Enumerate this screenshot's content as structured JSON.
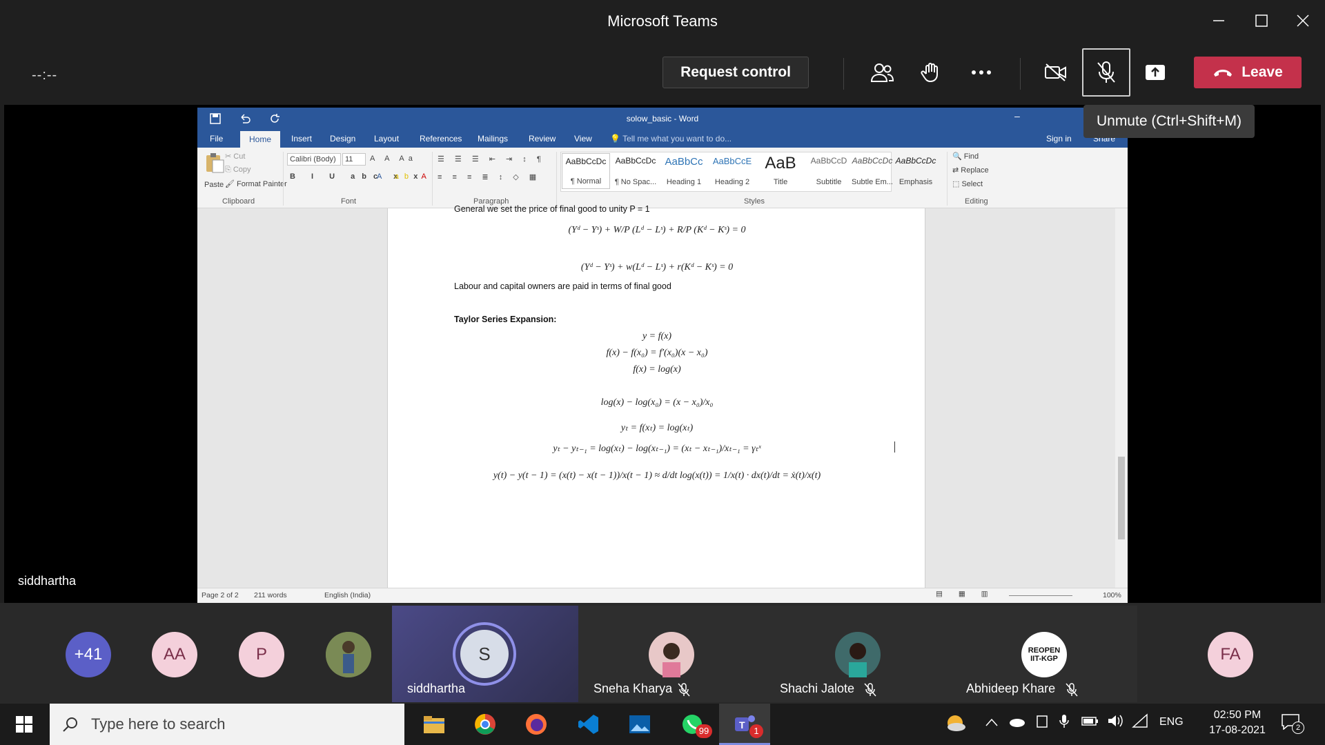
{
  "app": {
    "title": "Microsoft Teams"
  },
  "meeting": {
    "timer": "--:--",
    "request_control": "Request control",
    "leave": "Leave",
    "tooltip": "Unmute (Ctrl+Shift+M)",
    "presenter_label": "siddhartha"
  },
  "word": {
    "doc_title": "solow_basic - Word",
    "tabs": [
      "File",
      "Home",
      "Insert",
      "Design",
      "Layout",
      "References",
      "Mailings",
      "Review",
      "View"
    ],
    "tell_me": "Tell me what you want to do...",
    "sign_in": "Sign in",
    "share": "Share",
    "clipboard": {
      "paste": "Paste",
      "cut": "Cut",
      "copy": "Copy",
      "format_painter": "Format Painter",
      "label": "Clipboard"
    },
    "font": {
      "name": "Calibri (Body)",
      "size": "11",
      "label": "Font"
    },
    "paragraph_label": "Paragraph",
    "styles_label": "Styles",
    "styles": [
      {
        "sample": "AaBbCcDc",
        "name": "¶ Normal"
      },
      {
        "sample": "AaBbCcDc",
        "name": "¶ No Spac..."
      },
      {
        "sample": "AaBbCc",
        "name": "Heading 1"
      },
      {
        "sample": "AaBbCcE",
        "name": "Heading 2"
      },
      {
        "sample": "AaB",
        "name": "Title"
      },
      {
        "sample": "AaBbCcD",
        "name": "Subtitle"
      },
      {
        "sample": "AaBbCcDc",
        "name": "Subtle Em..."
      },
      {
        "sample": "AaBbCcDc",
        "name": "Emphasis"
      }
    ],
    "editing": {
      "find": "Find",
      "replace": "Replace",
      "select": "Select",
      "label": "Editing"
    },
    "document": {
      "line_top": "General we set the price of final good to unity P = 1",
      "eq1": "(Yᵈ − Yˢ) + W/P (Lᵈ − Lˢ) + R/P (Kᵈ − Kˢ) = 0",
      "eq2": "(Yᵈ − Yˢ) + w(Lᵈ − Lˢ) + r(Kᵈ − Kˢ) = 0",
      "text1": "Labour and capital owners are paid in terms of final good",
      "heading": "Taylor Series Expansion:",
      "eq3": "y = f(x)",
      "eq4": "f(x) − f(x₀) = f′(x₀)(x − x₀)",
      "eq5": "f(x) = log(x)",
      "eq6": "log(x) − log(x₀) = (x − x₀)/x₀",
      "eq7": "yₜ = f(xₜ) = log(xₜ)",
      "eq8": "yₜ − yₜ₋₁ = log(xₜ) − log(xₜ₋₁) = (xₜ − xₜ₋₁)/xₜ₋₁ = γₜˣ",
      "eq9": "y(t) − y(t − 1) = (x(t) − x(t − 1))/x(t − 1) ≈ d/dt log(x(t)) = 1/x(t) · dx(t)/dt = ẋ(t)/x(t)"
    },
    "status": {
      "page": "Page 2 of 2",
      "words": "211 words",
      "language": "English (India)",
      "zoom": "100%"
    }
  },
  "participants": [
    {
      "initials": "+41",
      "color": "#5b5fc7"
    },
    {
      "initials": "AA",
      "color": "#f4d0db"
    },
    {
      "initials": "P",
      "color": "#f4d0db"
    },
    {
      "initials": "",
      "color": "#6b7f4a"
    },
    {
      "initials": "S",
      "name": "siddhartha"
    },
    {
      "name": "Sneha Kharya"
    },
    {
      "name": "Shachi Jalote"
    },
    {
      "name": "Abhideep Khare",
      "badge": "REOPEN IIT-KGP"
    },
    {
      "initials": "FA",
      "color": "#f4d0db"
    }
  ],
  "taskbar": {
    "search_placeholder": "Type here to search",
    "whatsapp_badge": "99",
    "teams_badge": "1",
    "lang": "ENG",
    "time": "02:50 PM",
    "date": "17-08-2021",
    "notif_count": "2"
  }
}
